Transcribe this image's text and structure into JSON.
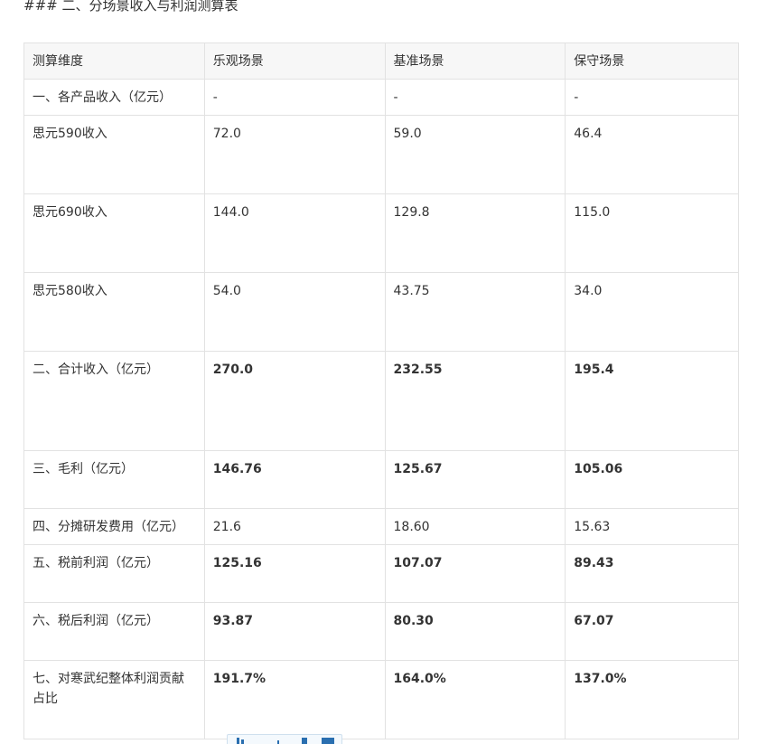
{
  "heading": "### 二、分场景收入与利润测算表",
  "table": {
    "headers": [
      "测算维度",
      "乐观场景",
      "基准场景",
      "保守场景"
    ],
    "rows": [
      {
        "label": "一、各产品收入（亿元）",
        "values": [
          "-",
          "-",
          "-"
        ],
        "bold": false
      },
      {
        "label": "思元590收入",
        "values": [
          "72.0",
          "59.0",
          "46.4"
        ],
        "bold": false
      },
      {
        "label": "思元690收入",
        "values": [
          "144.0",
          "129.8",
          "115.0"
        ],
        "bold": false
      },
      {
        "label": "思元580收入",
        "values": [
          "54.0",
          "43.75",
          "34.0"
        ],
        "bold": false
      },
      {
        "label": "二、合计收入（亿元）",
        "values": [
          "270.0",
          "232.55",
          "195.4"
        ],
        "bold": true
      },
      {
        "label": "三、毛利（亿元）",
        "values": [
          "146.76",
          "125.67",
          "105.06"
        ],
        "bold": true
      },
      {
        "label": "四、分摊研发费用（亿元）",
        "values": [
          "21.6",
          "18.60",
          "15.63"
        ],
        "bold": false
      },
      {
        "label": "五、税前利润（亿元）",
        "values": [
          "125.16",
          "107.07",
          "89.43"
        ],
        "bold": true
      },
      {
        "label": "六、税后利润（亿元）",
        "values": [
          "93.87",
          "80.30",
          "67.07"
        ],
        "bold": true
      },
      {
        "label": "七、对寒武纪整体利润贡献占比",
        "values": [
          "191.7%",
          "164.0%",
          "137.0%"
        ],
        "bold": true
      }
    ]
  },
  "toolbar": {
    "icon": "chart-toolbar-icon",
    "accent": "#2a6fb0"
  }
}
